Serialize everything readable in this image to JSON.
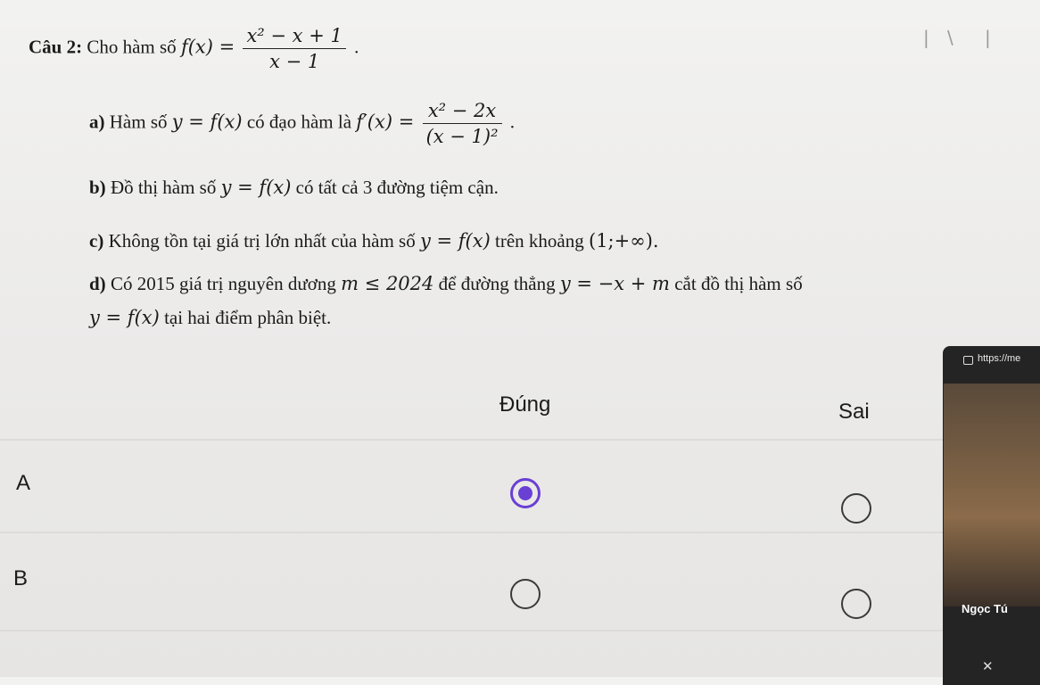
{
  "question": {
    "title": "Câu 2:",
    "intro": "Cho hàm số",
    "fx": "f(x) =",
    "frac_num": "x² − x + 1",
    "frac_den": "x − 1",
    "end": "."
  },
  "items": {
    "a": {
      "label": "a)",
      "t1": "Hàm số",
      "m1": "y = f(x)",
      "t2": "có đạo hàm là",
      "m2": "f′(x) =",
      "num": "x² − 2x",
      "den": "(x − 1)²",
      "end": "."
    },
    "b": {
      "label": "b)",
      "t1": "Đồ thị hàm số",
      "m1": "y = f(x)",
      "t2": "có tất cả 3 đường tiệm cận."
    },
    "c": {
      "label": "c)",
      "t1": "Không tồn tại giá trị lớn nhất của hàm số",
      "m1": "y = f(x)",
      "t2": "trên khoảng",
      "m2": "(1;+∞)."
    },
    "d": {
      "label": "d)",
      "t1": "Có 2015 giá trị nguyên dương",
      "m1": "m ≤ 2024",
      "t2": "để đường thẳng",
      "m2": "y = −x + m",
      "t3": "cắt đồ thị hàm số",
      "m3": "y = f(x)",
      "t4": "tại hai điểm phân biệt."
    }
  },
  "columns": {
    "true": "Đúng",
    "false": "Sai"
  },
  "rows": [
    {
      "label": "A",
      "selected": "true"
    },
    {
      "label": "B",
      "selected": "none"
    }
  ],
  "overlay": {
    "url": "https://me",
    "participant": "Ngọc Tú"
  }
}
